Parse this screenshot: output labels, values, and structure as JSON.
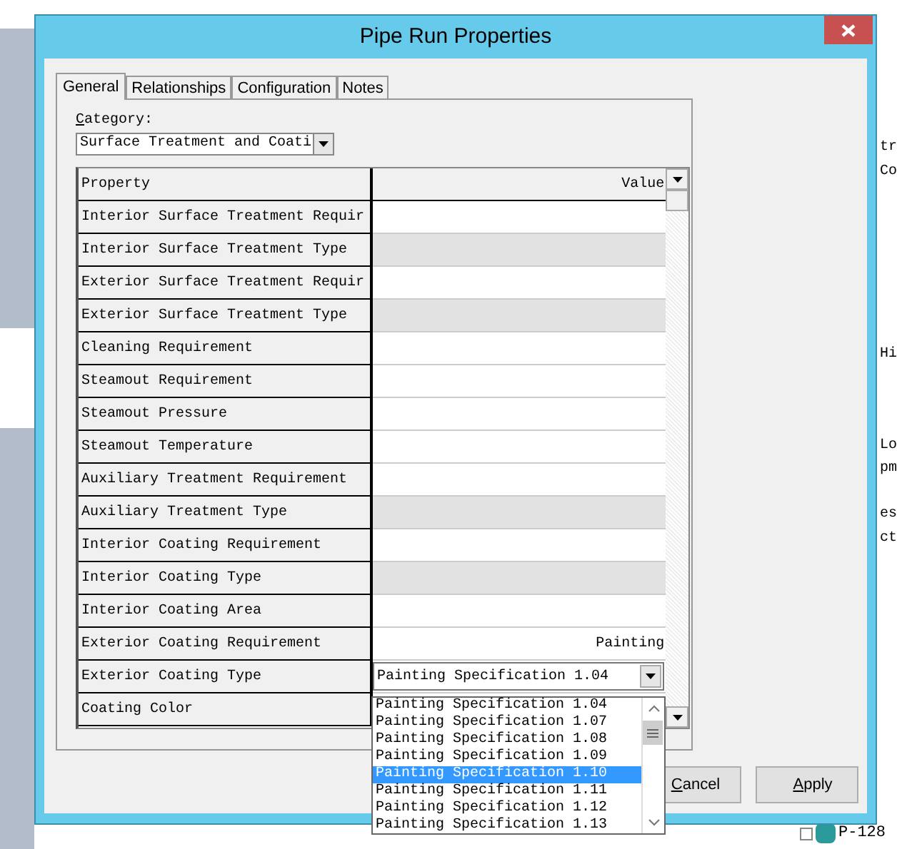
{
  "window": {
    "title": "Pipe Run Properties"
  },
  "tabs": [
    {
      "label": "General",
      "selected": true
    },
    {
      "label": "Relationships",
      "selected": false
    },
    {
      "label": "Configuration",
      "selected": false
    },
    {
      "label": "Notes",
      "selected": false
    }
  ],
  "category": {
    "label": "Category:",
    "value": "Surface Treatment and Coati"
  },
  "grid": {
    "columns": [
      "Property",
      "Value"
    ],
    "rows": [
      {
        "property": "Interior Surface Treatment Requir",
        "kind": "text",
        "shaded": false
      },
      {
        "property": "Interior Surface Treatment Type",
        "kind": "text",
        "shaded": true
      },
      {
        "property": "Exterior Surface Treatment Requir",
        "kind": "text",
        "shaded": false
      },
      {
        "property": "Exterior Surface Treatment Type",
        "kind": "text",
        "shaded": true
      },
      {
        "property": "Cleaning Requirement",
        "kind": "text",
        "shaded": false
      },
      {
        "property": "Steamout Requirement",
        "kind": "text",
        "shaded": false
      },
      {
        "property": "Steamout Pressure",
        "kind": "text",
        "shaded": false
      },
      {
        "property": "Steamout Temperature",
        "kind": "text",
        "shaded": false
      },
      {
        "property": "Auxiliary Treatment Requirement",
        "kind": "text",
        "shaded": false
      },
      {
        "property": "Auxiliary Treatment Type",
        "kind": "text",
        "shaded": true
      },
      {
        "property": "Interior Coating Requirement",
        "kind": "text",
        "shaded": false
      },
      {
        "property": "Interior Coating Type",
        "kind": "text",
        "shaded": true
      },
      {
        "property": "Interior Coating Area",
        "kind": "text",
        "shaded": false
      },
      {
        "property": "Exterior Coating Requirement",
        "kind": "text",
        "shaded": false,
        "value": "Painting"
      },
      {
        "property": "Exterior Coating Type",
        "kind": "combo",
        "shaded": false,
        "value": "Painting Specification 1.04"
      },
      {
        "property": "Coating Color",
        "kind": "text",
        "shaded": false
      }
    ]
  },
  "dropdown": {
    "items": [
      {
        "label": "Painting Specification 1.04",
        "selected": false
      },
      {
        "label": "Painting Specification 1.07",
        "selected": false
      },
      {
        "label": "Painting Specification 1.08",
        "selected": false
      },
      {
        "label": "Painting Specification 1.09",
        "selected": false
      },
      {
        "label": "Painting Specification 1.10",
        "selected": true
      },
      {
        "label": "Painting Specification 1.11",
        "selected": false
      },
      {
        "label": "Painting Specification 1.12",
        "selected": false
      },
      {
        "label": "Painting Specification 1.13",
        "selected": false
      }
    ]
  },
  "buttons": [
    {
      "label": "Cancel"
    },
    {
      "label": "Apply"
    }
  ],
  "background": {
    "texts": [
      "tr",
      "Co",
      "Hi",
      "Lo",
      "pm",
      "es",
      "ct"
    ],
    "tree_label": "P-128"
  }
}
